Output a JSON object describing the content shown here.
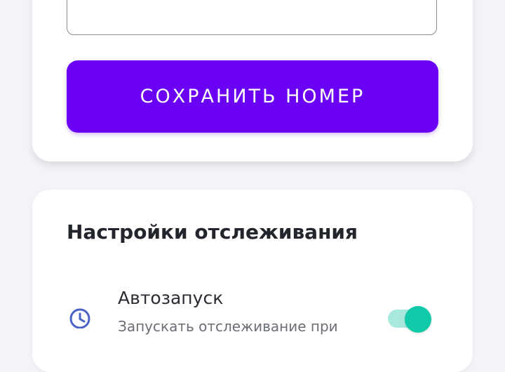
{
  "phone": {
    "value": ""
  },
  "save_button": {
    "label": "СОХРАНИТЬ НОМЕР"
  },
  "settings": {
    "title": "Настройки отслеживания",
    "items": [
      {
        "icon": "clock-icon",
        "label": "Автозапуск",
        "description": "Запускать отслеживание при",
        "enabled": true
      }
    ]
  },
  "colors": {
    "primary": "#6a00f4",
    "toggle_on": "#0fc9a8",
    "toggle_track": "#a8e9de",
    "icon": "#4a63c7"
  }
}
